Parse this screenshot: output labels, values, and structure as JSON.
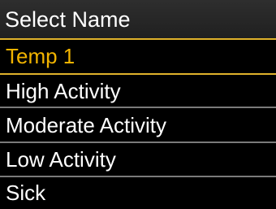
{
  "header": {
    "title": "Select Name"
  },
  "list": {
    "items": [
      {
        "label": "Temp 1"
      },
      {
        "label": "High Activity"
      },
      {
        "label": "Moderate Activity"
      },
      {
        "label": "Low Activity"
      },
      {
        "label": "Sick"
      }
    ],
    "selected_index": 0
  },
  "colors": {
    "background": "#000000",
    "header_background": "#262626",
    "text": "#ffffff",
    "selected_text": "#f2b400",
    "selected_border": "#e0b22b",
    "divider": "#7a7a7a"
  }
}
